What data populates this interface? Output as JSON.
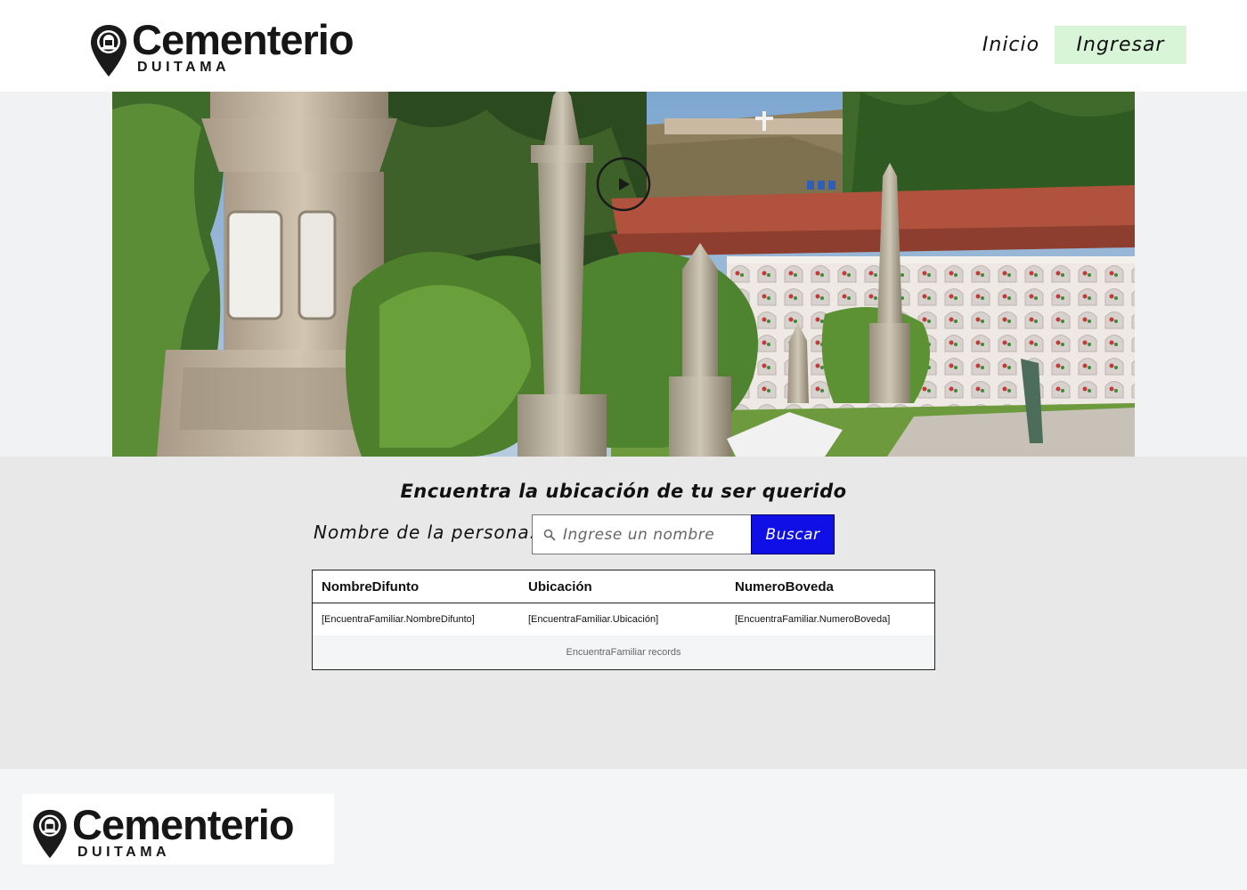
{
  "brand": {
    "name": "Cementerio",
    "sub": "DUITAMA"
  },
  "nav": {
    "inicio": "Inicio",
    "ingresar": "Ingresar"
  },
  "hero": {
    "image_icon": "cemetery-photo",
    "play_icon": "play-circle-icon"
  },
  "search": {
    "title": "Encuentra la ubicación de tu ser querido",
    "label": "Nombre de la persona:",
    "placeholder": "Ingrese un nombre",
    "value": "",
    "button": "Buscar"
  },
  "results": {
    "columns": [
      "NombreDifunto",
      "Ubicación",
      "NumeroBoveda"
    ],
    "rows": [
      [
        "[EncuentraFamiliar.NombreDifunto]",
        "[EncuentraFamiliar.Ubicación]",
        "[EncuentraFamiliar.NumeroBoveda]"
      ]
    ],
    "footer": "EncuentraFamiliar records"
  },
  "colors": {
    "accent_button": "#1010e6",
    "nav_highlight": "#d8f5d8",
    "section_bg": "#e8e8e8"
  }
}
